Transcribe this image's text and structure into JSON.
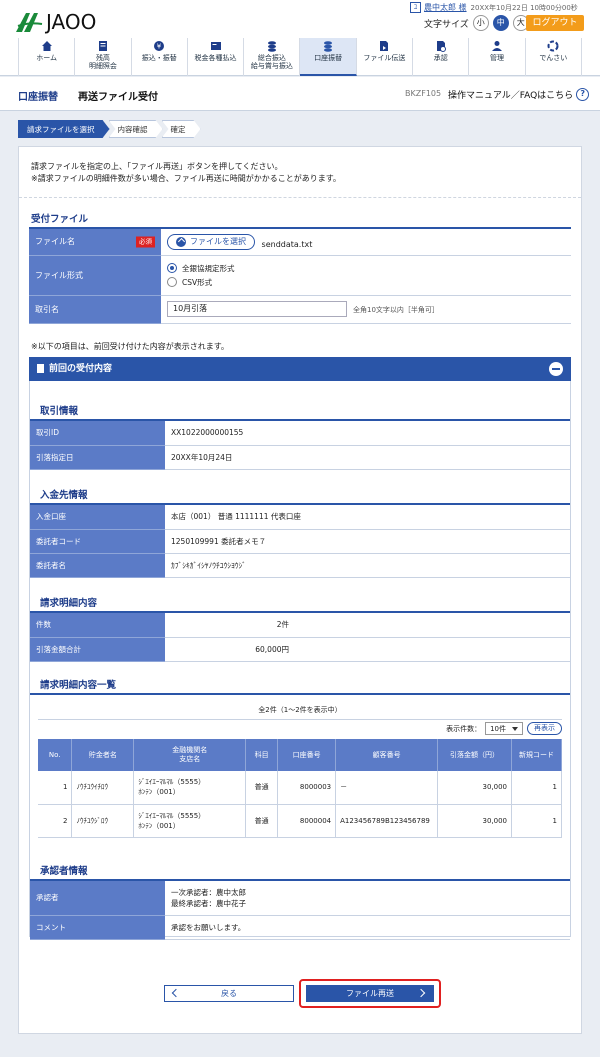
{
  "header": {
    "logo_text": "JAOO",
    "user_name": "農中太郎 様",
    "last_login": "20XX年10月22日 10時00分00秒",
    "font_size_label": "文字サイズ",
    "font_sizes": [
      "小",
      "中",
      "大"
    ],
    "font_size_selected": "中",
    "logout_label": "ログアウト"
  },
  "nav": [
    {
      "label": "ホーム",
      "icon": "home-icon"
    },
    {
      "label": "残高\n明細照会",
      "icon": "balance-icon"
    },
    {
      "label": "振込・振替",
      "icon": "transfer-icon"
    },
    {
      "label": "税金各種払込",
      "icon": "tax-icon"
    },
    {
      "label": "総合振込\n給与賞与振込",
      "icon": "bulk-transfer-icon"
    },
    {
      "label": "口座振替",
      "icon": "account-transfer-icon",
      "active": true
    },
    {
      "label": "ファイル伝送",
      "icon": "file-transfer-icon"
    },
    {
      "label": "承認",
      "icon": "approval-icon"
    },
    {
      "label": "管理",
      "icon": "admin-icon"
    },
    {
      "label": "でんさい",
      "icon": "densai-icon"
    }
  ],
  "page": {
    "category": "口座振替",
    "title": "再送ファイル受付",
    "screen_id": "BKZF105",
    "help_label": "操作マニュアル／FAQはこちら"
  },
  "steps": [
    "請求ファイルを選択",
    "内容確認",
    "確定"
  ],
  "intro": {
    "line1": "請求ファイルを指定の上、「ファイル再送」ボタンを押してください。",
    "line2": "※請求ファイルの明細件数が多い場合、ファイル再送に時間がかかることがあります。"
  },
  "upload": {
    "section_title": "受付ファイル",
    "file_label": "ファイル名",
    "required_label": "必須",
    "select_button": "ファイルを選択",
    "file_name": "senddata.txt",
    "format_label": "ファイル形式",
    "format_options": [
      "全銀協規定形式",
      "CSV形式"
    ],
    "format_selected": "全銀協規定形式",
    "deal_label": "取引名",
    "deal_value": "10月引落",
    "deal_hint": "全角10文字以内［半角可］"
  },
  "note2": "※以下の項目は、前回受け付けた内容が表示されます。",
  "previous": {
    "panel_title": "前回の受付内容",
    "deal_info_title": "取引情報",
    "deal_id_label": "取引ID",
    "deal_id": "XX1022000000155",
    "debit_date_label": "引落指定日",
    "debit_date": "20XX年10月24日",
    "payee_title": "入金先情報",
    "payee_account_label": "入金口座",
    "payee_account": "本店（001） 普通 1111111 代表口座",
    "consignor_code_label": "委託者コード",
    "consignor_code": "1250109991 委託者メモ７",
    "consignor_name_label": "委託者名",
    "consignor_name": "ｶﾌﾞｼｷｶﾞｲｼﾔﾉｳﾁﾕｳｼﾖｳｼﾞ",
    "detail_title": "請求明細内容",
    "count_label": "件数",
    "count": "2件",
    "total_label": "引落金額合計",
    "total": "60,000円",
    "list_title": "請求明細内容一覧",
    "list_summary": "全2件（1～2件を表示中）",
    "per_page_label": "表示件数：",
    "per_page": "10件",
    "redisplay": "再表示",
    "columns": [
      "No.",
      "貯金者名",
      "金融機関名\n支店名",
      "科目",
      "口座番号",
      "顧客番号",
      "引落金額（円）",
      "新規コード"
    ],
    "rows": [
      {
        "no": "1",
        "name": "ﾉｳﾁﾕｳｲﾁﾛｳ",
        "bank": "ｼﾞｴｲｴｰﾏﾙﾏﾙ（5555）",
        "branch": "ﾎﾝﾃﾝ（001）",
        "type": "普通",
        "acct": "8000003",
        "cust": "－",
        "amount": "30,000",
        "code": "1"
      },
      {
        "no": "2",
        "name": "ﾉｳﾁﾕｳｼﾞﾛｳ",
        "bank": "ｼﾞｴｲｴｰﾏﾙﾏﾙ（5555）",
        "branch": "ﾎﾝﾃﾝ（001）",
        "type": "普通",
        "acct": "8000004",
        "cust": "A123456789B123456789",
        "amount": "30,000",
        "code": "1"
      }
    ],
    "approver_title": "承認者情報",
    "approver_label": "承認者",
    "approver1": "一次承認者：農中太郎",
    "approver2": "最終承認者：農中花子",
    "comment_label": "コメント",
    "comment": "承認をお願いします。"
  },
  "buttons": {
    "back": "戻る",
    "resend": "ファイル再送"
  },
  "colors": {
    "primary": "#2a55a8",
    "header_cell": "#5b7bc7",
    "logout": "#f39c1a",
    "highlight": "#e02020"
  }
}
